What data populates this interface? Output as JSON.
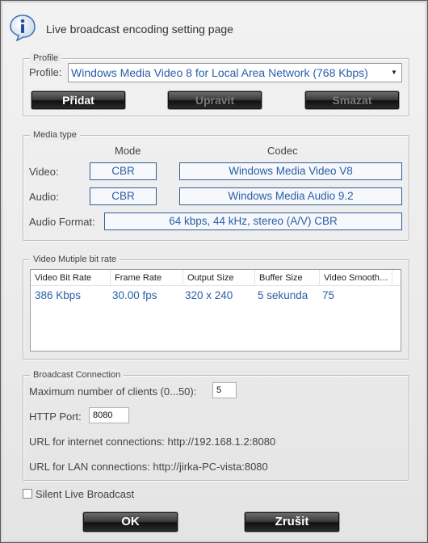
{
  "header": {
    "title": "Live broadcast encoding setting page",
    "icon": "info-icon"
  },
  "profile": {
    "legend": "Profile",
    "label": "Profile:",
    "selected": "Windows Media Video 8 for Local Area Network (768 Kbps)",
    "buttons": {
      "add": "Přidat",
      "edit": "Upravit",
      "delete": "Smazat"
    }
  },
  "media": {
    "legend": "Media type",
    "mode_header": "Mode",
    "codec_header": "Codec",
    "video_label": "Video:",
    "video_mode": "CBR",
    "video_codec": "Windows Media Video V8",
    "audio_label": "Audio:",
    "audio_mode": "CBR",
    "audio_codec": "Windows Media Audio 9.2",
    "format_label": "Audio Format:",
    "format_value": "64 kbps, 44 kHz, stereo (A/V) CBR"
  },
  "bitrate": {
    "legend": "Video Mutiple bit rate",
    "columns": [
      "Video Bit Rate",
      "Frame Rate",
      "Output Size",
      "Buffer Size",
      "Video Smooth…"
    ],
    "rows": [
      [
        "386 Kbps",
        "30.00 fps",
        "320 x 240",
        "5 sekunda",
        "75"
      ]
    ]
  },
  "connection": {
    "legend": "Broadcast Connection",
    "max_clients_label": "Maximum number of clients (0...50):",
    "max_clients_value": "5",
    "http_port_label": "HTTP Port:",
    "http_port_value": "8080",
    "internet_url": "URL for internet connections: http://192.168.1.2:8080",
    "lan_url": "URL for LAN connections: http://jirka-PC-vista:8080"
  },
  "silent": {
    "label": "Silent Live Broadcast",
    "checked": false
  },
  "footer": {
    "ok": "OK",
    "cancel": "Zrušit"
  }
}
